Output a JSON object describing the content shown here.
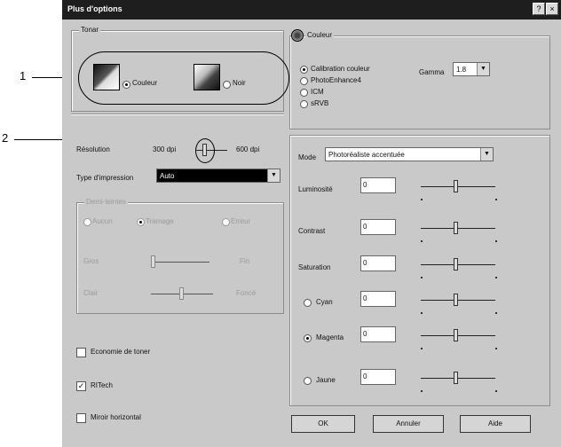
{
  "window": {
    "title": "Plus d'options",
    "help_btn": "?",
    "close_btn": "×"
  },
  "callouts": {
    "one": "1",
    "two": "2"
  },
  "tone": {
    "title": "Tonar",
    "color_label": "Couleur",
    "black_label": "Noir"
  },
  "resolution": {
    "label": "Résolution",
    "low": "300 dpi",
    "high": "600 dpi"
  },
  "print_type": {
    "label": "Type d'impression",
    "value": "Auto"
  },
  "halftone": {
    "title": "Demi-teintes",
    "options": [
      "Aucun",
      "Tramage",
      "Erreur"
    ],
    "rows": [
      {
        "left": "Gros",
        "right": "Fin"
      },
      {
        "left": "Clair",
        "right": "Foncé"
      }
    ]
  },
  "checks": {
    "toner_saving": "Economie de toner",
    "ritech": "RITech",
    "mirror": "Miroir horizontal"
  },
  "color_group": {
    "title": "Couleur",
    "options": [
      "Calibration couleur",
      "PhotoEnhance4",
      "ICM",
      "sRVB"
    ],
    "gamma_label": "Gamma",
    "gamma_value": "1.8"
  },
  "mode": {
    "label": "Mode",
    "value": "Photoréaliste accentuée"
  },
  "adjust": [
    {
      "label": "Luminosité",
      "value": "0"
    },
    {
      "label": "Contrast",
      "value": "0"
    },
    {
      "label": "Saturation",
      "value": "0"
    },
    {
      "label": "Cyan",
      "value": "0"
    },
    {
      "label": "Magenta",
      "value": "0"
    },
    {
      "label": "Jaune",
      "value": "0"
    }
  ],
  "buttons": {
    "ok": "OK",
    "cancel": "Annuler",
    "help": "Aide"
  }
}
